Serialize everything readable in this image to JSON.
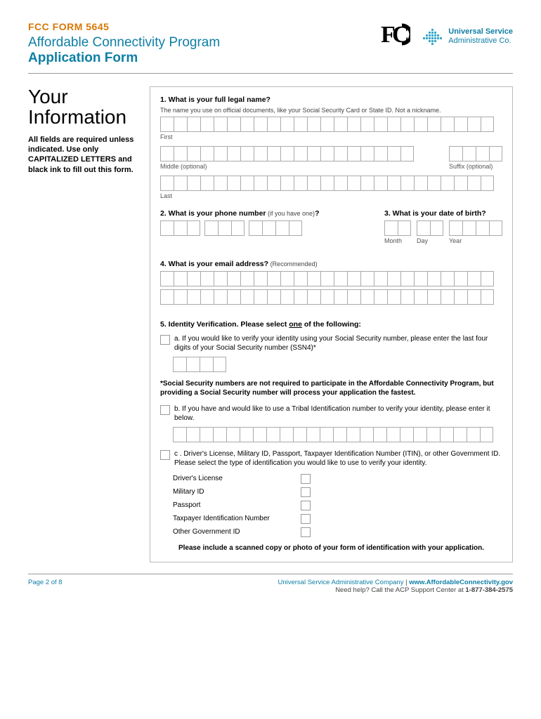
{
  "header": {
    "form_number": "FCC FORM 5645",
    "program_title": "Affordable Connectivity Program",
    "app_form": "Application Form",
    "fcc_text": "FC",
    "usac_line1": "Universal Service",
    "usac_line2": "Administrative Co."
  },
  "sidebar": {
    "title_line1": "Your",
    "title_line2": "Information",
    "instructions": "All fields are required unless indicated. Use only CAPITALIZED LETTERS and black ink to fill out this form."
  },
  "q1": {
    "label": "1. What is your full legal name?",
    "hint": "The name you use on official documents, like your Social Security Card or State ID. Not a nickname.",
    "first_label": "First",
    "middle_label": "Middle (optional)",
    "suffix_label": "Suffix (optional)",
    "last_label": "Last"
  },
  "q2": {
    "label": "2. What is your phone number",
    "note": " (if you have one)",
    "qmark": "?"
  },
  "q3": {
    "label": "3. What is your date of birth?",
    "month": "Month",
    "day": "Day",
    "year": "Year"
  },
  "q4": {
    "label": "4. What is your email address?",
    "note": " (Recommended)"
  },
  "q5": {
    "prefix": "5.",
    "title_a": " Identity Verification. Please select ",
    "underline": "one",
    "title_b": " of the following:",
    "opt_a": "a.    If you would like to verify your identity using your Social Security number, please enter the last four digits of your Social Security number (SSN4)*",
    "note": "*Social Security numbers are not required to participate in the Affordable Connectivity Program, but providing a Social Security number will process your application the fastest.",
    "opt_b": "b.    If you have and would like to use a Tribal Identification number to verify your identity, please enter it below.",
    "opt_c": "c .    Driver's License, Military ID, Passport, Taxpayer Identification Number (ITIN), or other Government ID. Please select the type of identification you would like to use to verify your identity.",
    "id_types": {
      "dl": "Driver's License",
      "mil": "Military ID",
      "pass": "Passport",
      "tin": "Taxpayer Identification Number",
      "other": "Other Government ID"
    },
    "final": "Please include a scanned copy or photo of your form of identification with your application."
  },
  "footer": {
    "page": "Page 2 of 8",
    "company": "Universal Service Administrative Company",
    "sep": " | ",
    "url": "www.AffordableConnectivity.gov",
    "help": "Need help? Call the ACP Support Center at ",
    "phone": "1-877-384-2575"
  }
}
